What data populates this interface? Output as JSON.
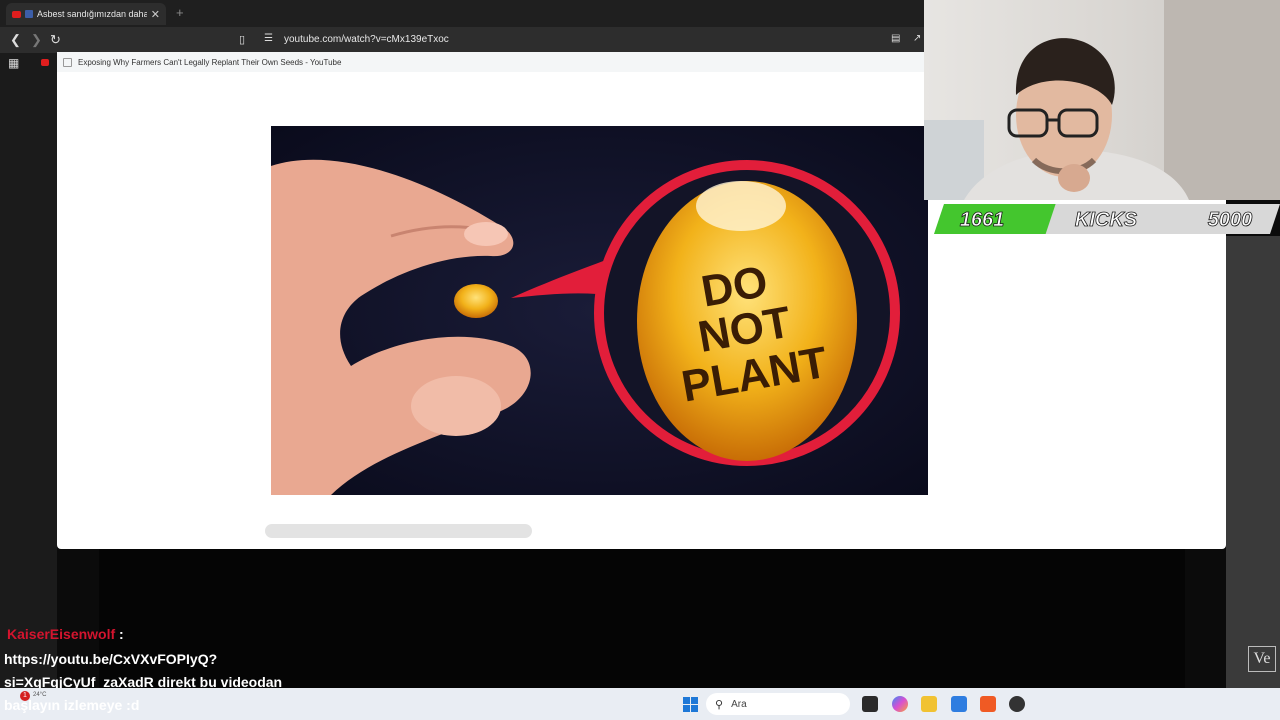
{
  "browser": {
    "tab_title": "Asbest sandığımızdan daha b",
    "tab_close": "✕",
    "new_tab": "+",
    "url": "youtube.com/watch?v=cMx139eTxoc"
  },
  "popup": {
    "title": "Exposing Why Farmers Can't Legally Replant Their Own Seeds - YouTube"
  },
  "thumbnail": {
    "text_line1": "DO",
    "text_line2": "NOT",
    "text_line3": "PLANT"
  },
  "goal_bar": {
    "current": "1661",
    "label": "KICKS",
    "target": "5000",
    "progress": 0.3322,
    "fill_color": "#44c62e"
  },
  "chat": {
    "username": "KaiserEisenwolf",
    "colon": ":",
    "lines": [
      "https://youtu.be/CxVXvFOPIyQ?",
      "si=XqFqjCyUf_zaXadR direkt bu videodan",
      "başlayın izlemeye :d"
    ],
    "username_color": "#d4142e"
  },
  "overlay_logo": "Ve",
  "taskbar": {
    "weather_badge": "1",
    "weather_temp": "24°C",
    "search_placeholder": "Ara"
  },
  "icons": [
    "back-icon",
    "forward-icon",
    "reload-icon",
    "bookmark-icon",
    "site-settings-icon",
    "apps-icon",
    "cast-icon",
    "share-icon",
    "search-icon",
    "windows-start-icon"
  ]
}
